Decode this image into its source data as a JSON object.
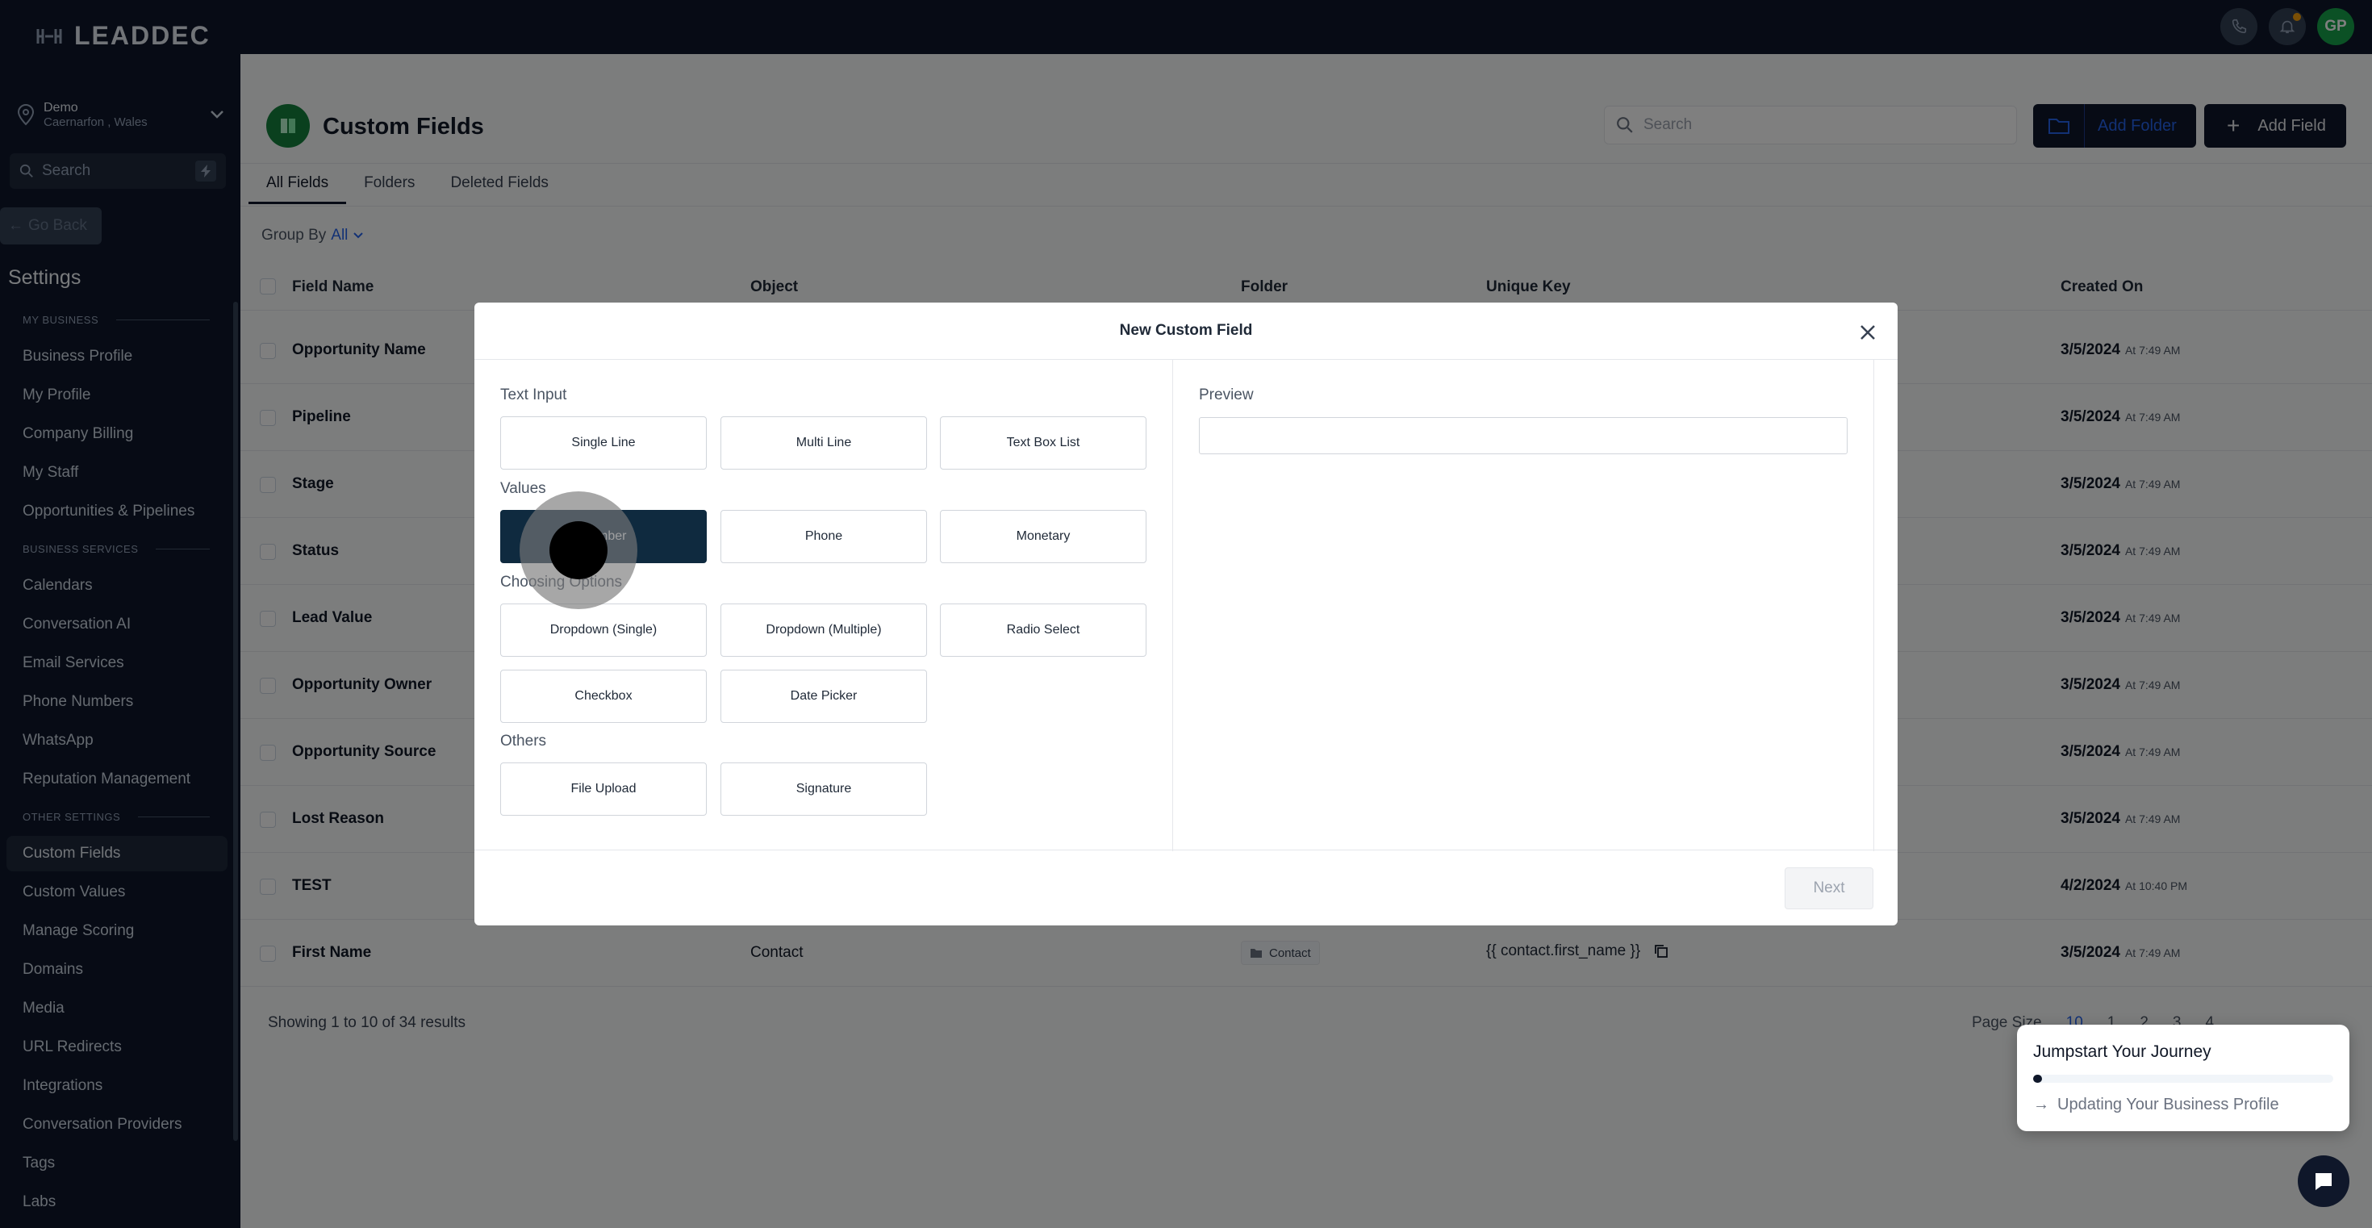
{
  "brand": {
    "logo_text": "LEADDEC"
  },
  "location": {
    "name": "Demo",
    "sub": "Caernarfon , Wales"
  },
  "sidebar": {
    "search_placeholder": "Search",
    "go_back": "Go Back",
    "settings_title": "Settings",
    "sections": [
      "MY BUSINESS",
      "BUSINESS SERVICES",
      "OTHER SETTINGS"
    ],
    "items": [
      "Business Profile",
      "My Profile",
      "Company Billing",
      "My Staff",
      "Opportunities & Pipelines",
      "Calendars",
      "Conversation AI",
      "Email Services",
      "Phone Numbers",
      "WhatsApp",
      "Reputation Management",
      "Custom Fields",
      "Custom Values",
      "Manage Scoring",
      "Domains",
      "Media",
      "URL Redirects",
      "Integrations",
      "Conversation Providers",
      "Tags",
      "Labs"
    ],
    "active_item": "Custom Fields"
  },
  "topbar": {
    "avatar_initials": "GP"
  },
  "header": {
    "title": "Custom Fields",
    "search_placeholder": "Search",
    "add_folder": "Add Folder",
    "add_field": "Add Field"
  },
  "tabs": [
    "All Fields",
    "Folders",
    "Deleted Fields"
  ],
  "group_by": {
    "label": "Group By",
    "value": "All"
  },
  "table": {
    "columns": [
      "Field Name",
      "Object",
      "Folder",
      "Unique Key",
      "Created On"
    ],
    "rows": [
      {
        "name": "Opportunity Name",
        "date": "3/5/2024",
        "time": "At 7:49 AM"
      },
      {
        "name": "Pipeline",
        "date": "3/5/2024",
        "time": "At 7:49 AM"
      },
      {
        "name": "Stage",
        "date": "3/5/2024",
        "time": "At 7:49 AM"
      },
      {
        "name": "Status",
        "date": "3/5/2024",
        "time": "At 7:49 AM"
      },
      {
        "name": "Lead Value",
        "date": "3/5/2024",
        "time": "At 7:49 AM"
      },
      {
        "name": "Opportunity Owner",
        "date": "3/5/2024",
        "time": "At 7:49 AM"
      },
      {
        "name": "Opportunity Source",
        "date": "3/5/2024",
        "time": "At 7:49 AM"
      },
      {
        "name": "Lost Reason",
        "date": "3/5/2024",
        "time": "At 7:49 AM"
      },
      {
        "name": "TEST",
        "date": "4/2/2024",
        "time": "At 10:40 PM"
      },
      {
        "name": "First Name",
        "object": "Contact",
        "folder": "Contact",
        "key": "{{ contact.first_name }}",
        "date": "3/5/2024",
        "time": "At 7:49 AM"
      }
    ],
    "showing": "Showing 1 to 10 of 34 results",
    "page_size_label": "Page Size",
    "page_size_value": "10",
    "pages": [
      "1",
      "2",
      "3",
      "4"
    ]
  },
  "modal": {
    "title": "New Custom Field",
    "groups": [
      {
        "label": "Text Input",
        "options": [
          "Single Line",
          "Multi Line",
          "Text Box List"
        ]
      },
      {
        "label": "Values",
        "options": [
          "Number",
          "Phone",
          "Monetary"
        ]
      },
      {
        "label": "Choosing Options",
        "options": [
          "Dropdown (Single)",
          "Dropdown (Multiple)",
          "Radio Select",
          "Checkbox",
          "Date Picker"
        ]
      },
      {
        "label": "Others",
        "options": [
          "File Upload",
          "Signature"
        ]
      }
    ],
    "selected_option": "Number",
    "preview_label": "Preview",
    "next_label": "Next"
  },
  "journey": {
    "title": "Jumpstart Your Journey",
    "progress": 0.03,
    "step": "Updating Your Business Profile"
  },
  "colors": {
    "sidebar_bg": "#0f172a",
    "accent_blue": "#2563eb",
    "badge_green": "#15803d",
    "selected_option_bg": "#0f2a3f"
  }
}
